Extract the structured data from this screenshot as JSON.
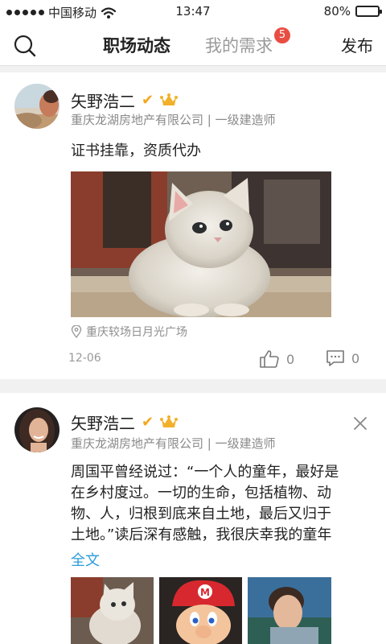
{
  "status_bar": {
    "carrier": "中国移动",
    "time": "13:47",
    "battery": "80%",
    "battery_level": 0.8
  },
  "nav": {
    "tab_active": "职场动态",
    "tab_other": "我的需求",
    "badge": "5",
    "publish": "发布"
  },
  "posts": [
    {
      "name": "矢野浩二",
      "company": "重庆龙湖房地产有限公司 | 一级建造师",
      "content": "证书挂靠，资质代办",
      "location": "重庆较场日月光广场",
      "date": "12-06",
      "likes": "0",
      "comments": "0"
    },
    {
      "name": "矢野浩二",
      "company": "重庆龙湖房地产有限公司 | 一级建造师",
      "content_lines": [
        "周国平曾经说过：“一个人的童年，最好是",
        "在乡村度过。一切的生命，包括植物、动",
        "物、人，归根到底来自土地，最后又归于",
        "土地。”读后深有感触，我很庆幸我的童年"
      ],
      "full_text": "全文"
    }
  ],
  "colors": {
    "accent": "#2d9cdb",
    "badge": "#e94d42",
    "verified": "#f2a81d"
  }
}
